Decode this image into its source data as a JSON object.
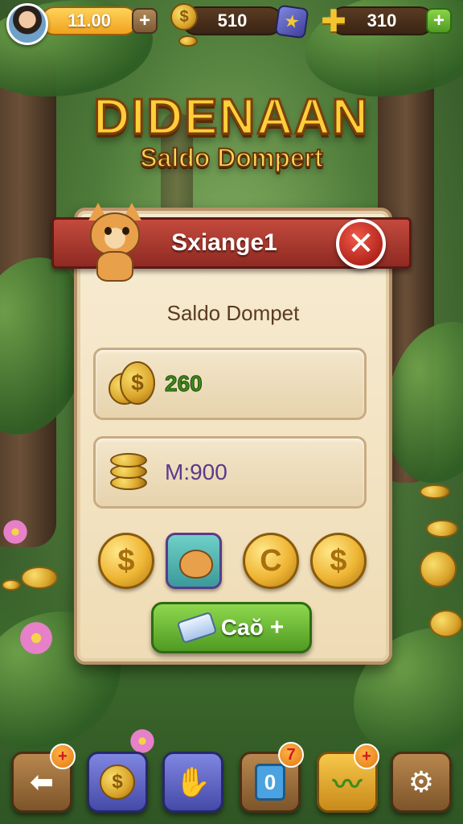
{
  "top_bar": {
    "level_value": "11.00",
    "coins_value": "510",
    "gems_value": "310",
    "plus_label": "+"
  },
  "title": "DIDENAAN",
  "subtitle": "Saldo Dompert",
  "panel": {
    "ribbon_title": "Sxiange1",
    "close_label": "✕",
    "section_label": "Saldo Dompet",
    "rows": [
      {
        "value": "260",
        "icon": "gold-coins-icon",
        "color": "#3f8a1c"
      },
      {
        "value": "M:900",
        "icon": "coin-stack-icon",
        "color": "#5a3a8a"
      }
    ],
    "quick_items": [
      {
        "icon": "dollar-coin-icon",
        "glyph": "$"
      },
      {
        "icon": "cat-card-icon",
        "glyph": ""
      },
      {
        "icon": "c-coin-icon",
        "glyph": "C"
      },
      {
        "icon": "dollar-coin-icon",
        "glyph": "$"
      }
    ],
    "claim_button": {
      "label": "Caŏ",
      "plus": "+"
    }
  },
  "bottom_nav": [
    {
      "icon": "back-arrow-icon",
      "glyph": "⬅",
      "badge": "+"
    },
    {
      "icon": "coin-star-icon",
      "glyph": "$",
      "badge": ""
    },
    {
      "icon": "glove-icon",
      "glyph": "✋",
      "badge": ""
    },
    {
      "icon": "card-icon",
      "glyph": "0",
      "badge": "7"
    },
    {
      "icon": "pepper-icon",
      "glyph": "〰",
      "badge": "+"
    },
    {
      "icon": "settings-gear-icon",
      "glyph": "⚙",
      "badge": ""
    }
  ],
  "colors": {
    "accent_gold": "#ffcf3a",
    "ribbon_red": "#b3251c",
    "button_green": "#4f9a22",
    "panel_parchment": "#f7ecd3"
  }
}
